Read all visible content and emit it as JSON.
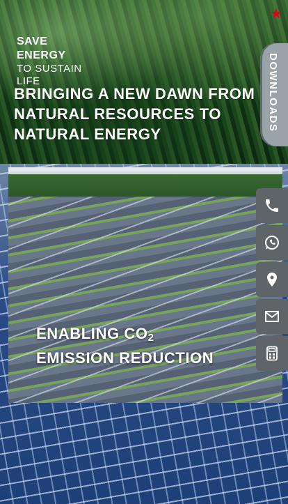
{
  "brand": {
    "line1": "SAVE",
    "line2": "ENERGY",
    "line3": "TO SUSTAIN",
    "line4": "LIFE"
  },
  "hero": {
    "title": "BRINGING A NEW DAWN FROM NATURAL RESOURCES TO NATURAL ENERGY"
  },
  "downloads_tab": {
    "label": "DOWNLOADS"
  },
  "video": {
    "title_line1_prefix": "ENABLING CO",
    "title_line1_sub": "2",
    "title_line2": "EMISSION REDUCTION"
  },
  "contact_icons": [
    "phone-icon",
    "whatsapp-icon",
    "location-pin-icon",
    "email-icon",
    "calculator-icon"
  ],
  "colors": {
    "accent_red": "#e1001a",
    "tab_grey": "#9aa4a8",
    "contact_grey": "#5e6468"
  }
}
